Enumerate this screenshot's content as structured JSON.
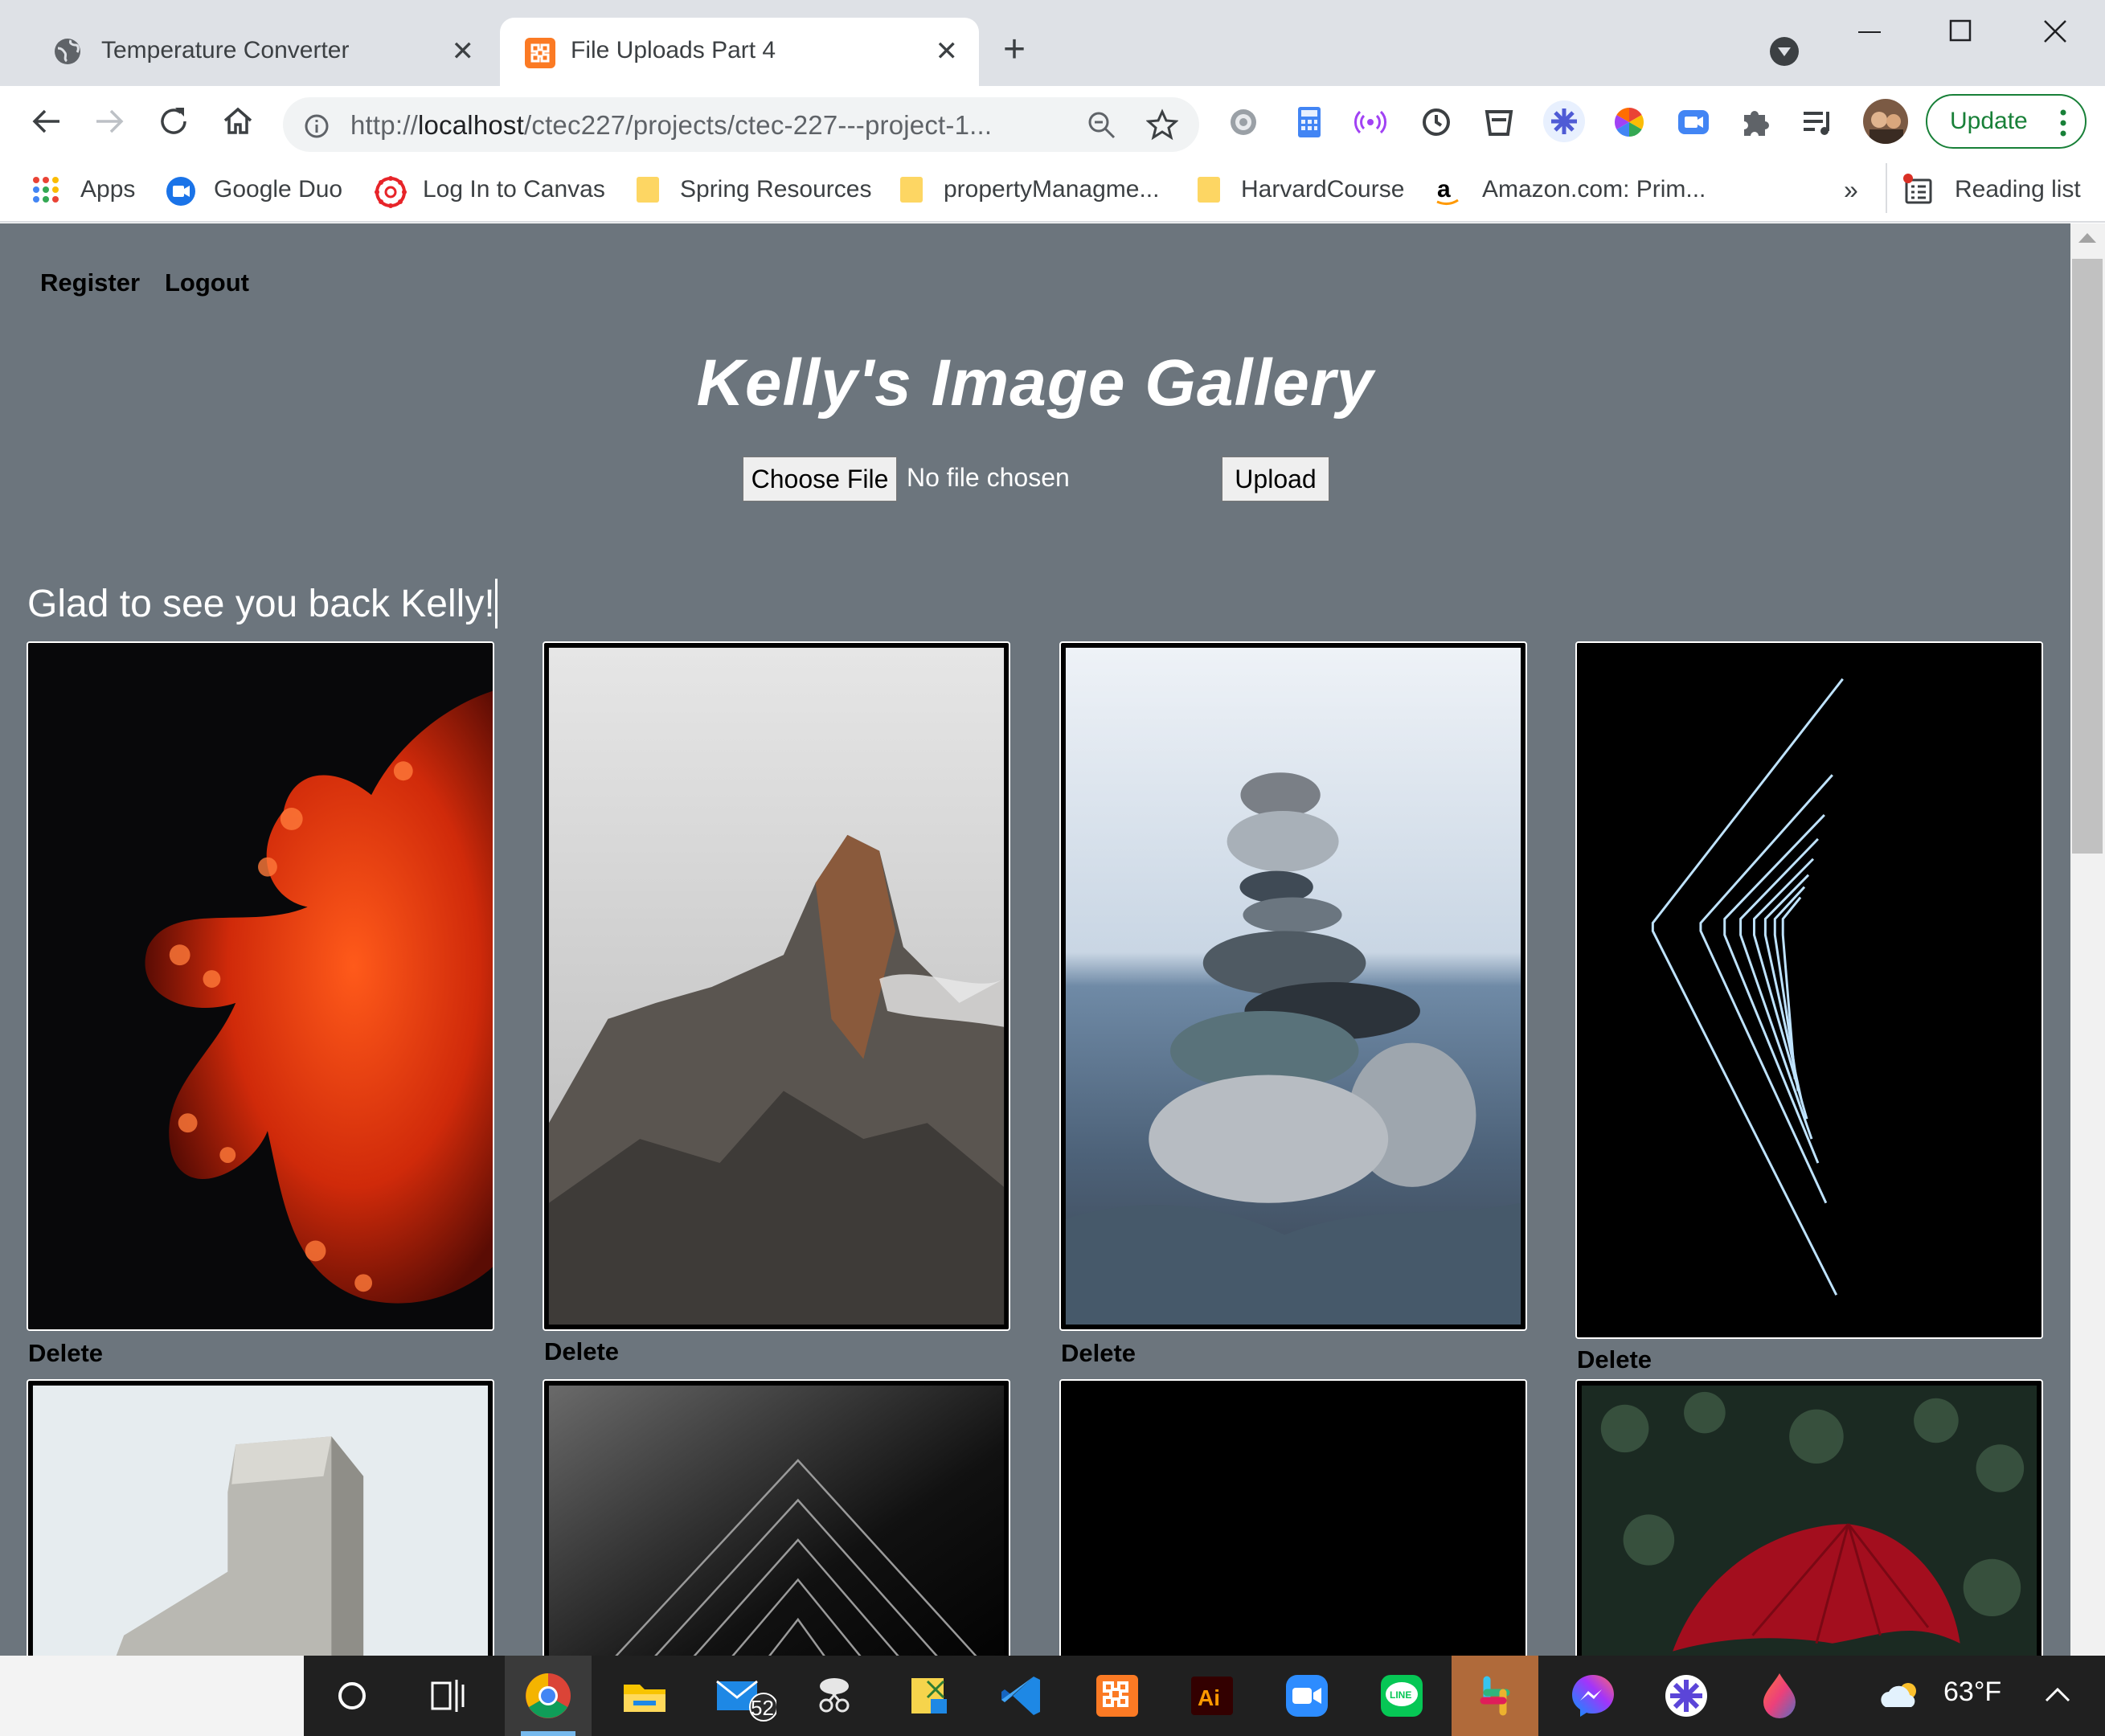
{
  "browser": {
    "tabs": [
      {
        "title": "Temperature Converter",
        "active": false
      },
      {
        "title": "File Uploads Part 4",
        "active": true
      }
    ],
    "url_prefix": "http://",
    "url_host": "localhost",
    "url_path": "/ctec227/projects/ctec-227---project-1...",
    "update_label": "Update",
    "bookmarks": [
      "Apps",
      "Google Duo",
      "Log In to Canvas",
      "Spring Resources",
      "propertyManagme...",
      "HarvardCourse",
      "Amazon.com: Prim..."
    ],
    "more_bookmarks": "»",
    "reading_list": "Reading list"
  },
  "page": {
    "nav": {
      "register": "Register",
      "logout": "Logout"
    },
    "title": "Kelly's Image Gallery",
    "upload": {
      "choose_label": "Choose File",
      "no_file": "No file chosen",
      "upload_label": "Upload"
    },
    "welcome": "Glad to see you back Kelly!",
    "images": [
      {
        "subject": "red octopus on black",
        "delete_label": "Delete"
      },
      {
        "subject": "misty rocky mountain peak",
        "delete_label": "Delete"
      },
      {
        "subject": "stacked stones by the sea",
        "delete_label": "Delete"
      },
      {
        "subject": "neon line chevrons on black",
        "delete_label": "Delete"
      },
      {
        "subject": "concrete block against sky"
      },
      {
        "subject": "dark geometric pyramid"
      },
      {
        "subject": "black image"
      },
      {
        "subject": "red umbrella in dark foliage"
      }
    ]
  },
  "taskbar": {
    "mail_badge": "52",
    "temperature": "63°F"
  },
  "colors": {
    "page_background": "#6c757d",
    "tab_strip": "#dee1e6",
    "update_green": "#188038"
  }
}
